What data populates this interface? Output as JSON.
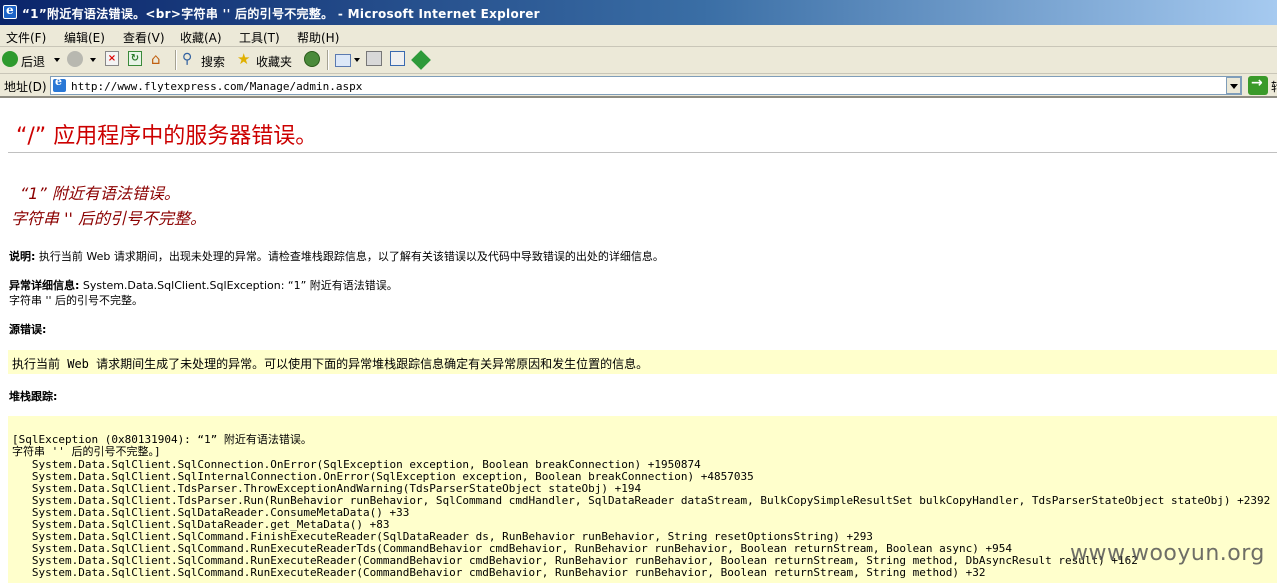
{
  "window": {
    "title": "“1”附近有语法错误。<br>字符串 '' 后的引号不完整。 - Microsoft Internet Explorer"
  },
  "menu": [
    "文件(F)",
    "编辑(E)",
    "查看(V)",
    "收藏(A)",
    "工具(T)",
    "帮助(H)"
  ],
  "toolbar": {
    "back_label": "后退",
    "search_label": "搜索",
    "favorites_label": "收藏夹"
  },
  "address": {
    "label": "地址(D)",
    "url": "http://www.flytexpress.com/Manage/admin.aspx",
    "go_label": "转"
  },
  "page": {
    "heading": "“/” 应用程序中的服务器错误。",
    "error_line1": "“1” 附近有语法错误。",
    "error_line2": "字符串 '' 后的引号不完整。",
    "description_label": "说明:",
    "description_text": "执行当前 Web 请求期间，出现未处理的异常。请检查堆栈跟踪信息，以了解有关该错误以及代码中导致错误的出处的详细信息。",
    "exception_label": "异常详细信息:",
    "exception_text": "System.Data.SqlClient.SqlException: “1” 附近有语法错误。",
    "exception_text2": "字符串 '' 后的引号不完整。",
    "source_error_label": "源错误:",
    "source_error_text": "执行当前 Web 请求期间生成了未处理的异常。可以使用下面的异常堆栈跟踪信息确定有关异常原因和发生位置的信息。",
    "stack_trace_label": "堆栈跟踪:",
    "stack_trace": [
      "[SqlException (0x80131904): “1” 附近有语法错误。",
      "字符串 '' 后的引号不完整。]",
      "   System.Data.SqlClient.SqlConnection.OnError(SqlException exception, Boolean breakConnection) +1950874",
      "   System.Data.SqlClient.SqlInternalConnection.OnError(SqlException exception, Boolean breakConnection) +4857035",
      "   System.Data.SqlClient.TdsParser.ThrowExceptionAndWarning(TdsParserStateObject stateObj) +194",
      "   System.Data.SqlClient.TdsParser.Run(RunBehavior runBehavior, SqlCommand cmdHandler, SqlDataReader dataStream, BulkCopySimpleResultSet bulkCopyHandler, TdsParserStateObject stateObj) +2392",
      "   System.Data.SqlClient.SqlDataReader.ConsumeMetaData() +33",
      "   System.Data.SqlClient.SqlDataReader.get_MetaData() +83",
      "   System.Data.SqlClient.SqlCommand.FinishExecuteReader(SqlDataReader ds, RunBehavior runBehavior, String resetOptionsString) +293",
      "   System.Data.SqlClient.SqlCommand.RunExecuteReaderTds(CommandBehavior cmdBehavior, RunBehavior runBehavior, Boolean returnStream, Boolean async) +954",
      "   System.Data.SqlClient.SqlCommand.RunExecuteReader(CommandBehavior cmdBehavior, RunBehavior runBehavior, Boolean returnStream, String method, DbAsyncResult result) +162",
      "   System.Data.SqlClient.SqlCommand.RunExecuteReader(CommandBehavior cmdBehavior, RunBehavior runBehavior, Boolean returnStream, String method) +32"
    ]
  },
  "watermark": "www.wooyun.org",
  "colors": {
    "heading_red": "#cc0000",
    "error_darkred": "#8b0000",
    "code_background": "#ffffcc",
    "chrome_background": "#ece9d8"
  }
}
